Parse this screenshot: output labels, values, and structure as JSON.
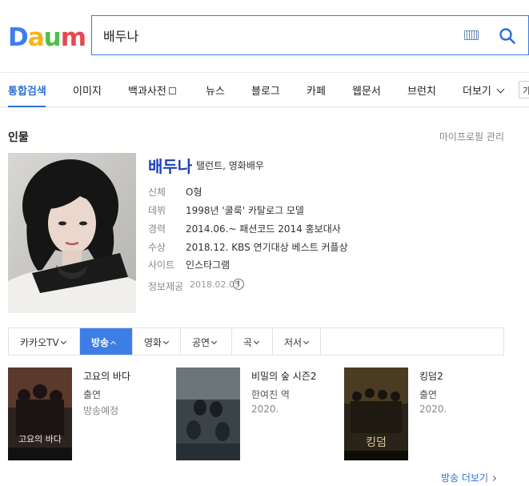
{
  "brand": {
    "logo_letters": [
      "D",
      "a",
      "u",
      "m"
    ],
    "logo_colors": [
      "#3c7df0",
      "#f8b416",
      "#51bf46",
      "#e8474c"
    ]
  },
  "search": {
    "query": "배두나",
    "keyboard_icon": "keyboard-icon",
    "search_icon": "search-icon"
  },
  "tabs": [
    {
      "label": "통합검색",
      "active": true
    },
    {
      "label": "이미지"
    },
    {
      "label": "백과사전"
    },
    {
      "label": "뉴스"
    },
    {
      "label": "블로그"
    },
    {
      "label": "카페"
    },
    {
      "label": "웹문서"
    },
    {
      "label": "브런치"
    },
    {
      "label": "더보기"
    }
  ],
  "tabbar_cutoff_label": "가",
  "person": {
    "section_title": "인물",
    "profile_manage": "마이프로필 관리",
    "name": "배두나",
    "role": "탤런트, 영화배우",
    "info": [
      {
        "label": "신체",
        "value": "O형"
      },
      {
        "label": "데뷔",
        "value": "1998년 '쿨룩' 카탈로그 모델"
      },
      {
        "label": "경력",
        "value": "2014.06.~ 패션코드 2014 홍보대사"
      },
      {
        "label": "수상",
        "value": "2018.12. KBS 연기대상 베스트 커플상"
      },
      {
        "label": "사이트",
        "value": "인스타그램"
      },
      {
        "label": "정보제공",
        "value": "2018.02.05."
      }
    ],
    "info_icon_glyph": "!"
  },
  "categories": [
    {
      "label": "카카오TV"
    },
    {
      "label": "방송",
      "active": true
    },
    {
      "label": "영화"
    },
    {
      "label": "공연"
    },
    {
      "label": "곡"
    },
    {
      "label": "저서"
    }
  ],
  "works": [
    {
      "title": "고요의 바다",
      "line1": "출연",
      "line2": "방송예정",
      "poster_text": "고요의 바다"
    },
    {
      "title": "비밀의 숲 시즌2",
      "line1": "한여진 역",
      "line2": "2020."
    },
    {
      "title": "킹덤2",
      "line1": "출연",
      "line2": "2020.",
      "poster_text": "킹덤"
    }
  ],
  "more_broadcast": "방송 더보기"
}
